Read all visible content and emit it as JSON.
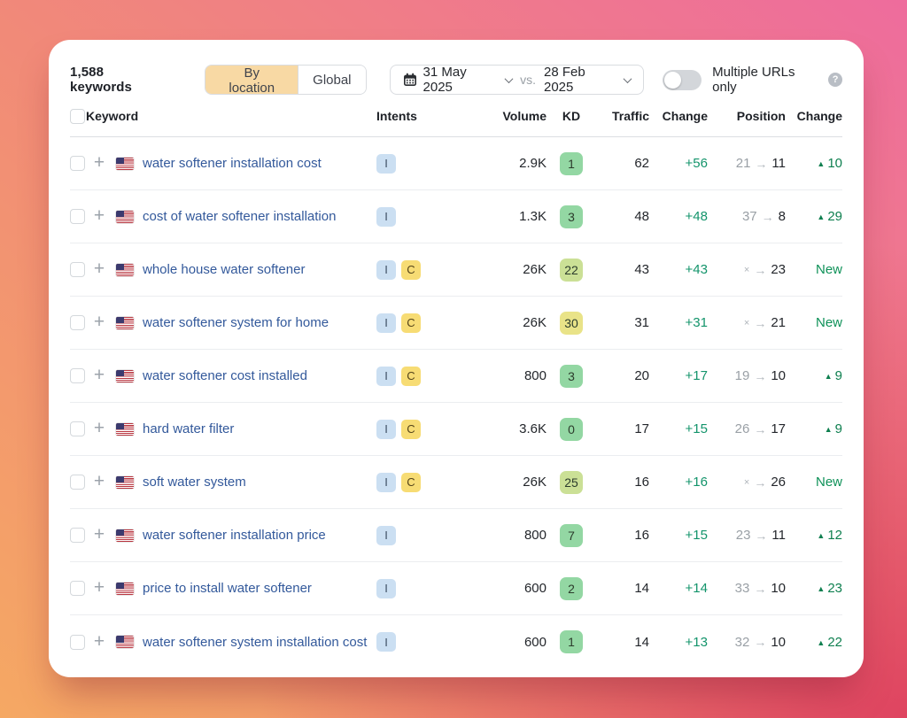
{
  "toolbar": {
    "keywords_count": "1,588 keywords",
    "view_toggle": {
      "by_location": "By location",
      "global": "Global",
      "active": "By location"
    },
    "date_picker": {
      "start_date": "31 May 2025",
      "separator": "vs.",
      "end_date": "28 Feb 2025"
    },
    "multiple_urls_toggle": {
      "label": "Multiple URLs only",
      "state": "off",
      "help_symbol": "?"
    }
  },
  "table": {
    "columns": [
      "Keyword",
      "Intents",
      "Volume",
      "KD",
      "Traffic",
      "Change",
      "Position",
      "Change"
    ],
    "symbols": {
      "position_arrow": "→",
      "up_triangle": "▲",
      "not_ranked": "×",
      "add": "+"
    },
    "rows": [
      {
        "keyword": "water softener installation cost",
        "country": "us",
        "intents": [
          "I"
        ],
        "volume": "2.9K",
        "kd": "1",
        "kd_level": "green",
        "traffic": "62",
        "change": "+56",
        "position_from": "21",
        "position_to": "11",
        "position_change": "10",
        "position_change_type": "up"
      },
      {
        "keyword": "cost of water softener installation",
        "country": "us",
        "intents": [
          "I"
        ],
        "volume": "1.3K",
        "kd": "3",
        "kd_level": "green",
        "traffic": "48",
        "change": "+48",
        "position_from": "37",
        "position_to": "8",
        "position_change": "29",
        "position_change_type": "up"
      },
      {
        "keyword": "whole house water softener",
        "country": "us",
        "intents": [
          "I",
          "C"
        ],
        "volume": "26K",
        "kd": "22",
        "kd_level": "lime",
        "traffic": "43",
        "change": "+43",
        "position_from": "×",
        "position_to": "23",
        "position_change": "New",
        "position_change_type": "new"
      },
      {
        "keyword": "water softener system for home",
        "country": "us",
        "intents": [
          "I",
          "C"
        ],
        "volume": "26K",
        "kd": "30",
        "kd_level": "yellow",
        "traffic": "31",
        "change": "+31",
        "position_from": "×",
        "position_to": "21",
        "position_change": "New",
        "position_change_type": "new"
      },
      {
        "keyword": "water softener cost installed",
        "country": "us",
        "intents": [
          "I",
          "C"
        ],
        "volume": "800",
        "kd": "3",
        "kd_level": "green",
        "traffic": "20",
        "change": "+17",
        "position_from": "19",
        "position_to": "10",
        "position_change": "9",
        "position_change_type": "up"
      },
      {
        "keyword": "hard water filter",
        "country": "us",
        "intents": [
          "I",
          "C"
        ],
        "volume": "3.6K",
        "kd": "0",
        "kd_level": "green",
        "traffic": "17",
        "change": "+15",
        "position_from": "26",
        "position_to": "17",
        "position_change": "9",
        "position_change_type": "up"
      },
      {
        "keyword": "soft water system",
        "country": "us",
        "intents": [
          "I",
          "C"
        ],
        "volume": "26K",
        "kd": "25",
        "kd_level": "lime",
        "traffic": "16",
        "change": "+16",
        "position_from": "×",
        "position_to": "26",
        "position_change": "New",
        "position_change_type": "new"
      },
      {
        "keyword": "water softener installation price",
        "country": "us",
        "intents": [
          "I"
        ],
        "volume": "800",
        "kd": "7",
        "kd_level": "green",
        "traffic": "16",
        "change": "+15",
        "position_from": "23",
        "position_to": "11",
        "position_change": "12",
        "position_change_type": "up"
      },
      {
        "keyword": "price to install water softener",
        "country": "us",
        "intents": [
          "I"
        ],
        "volume": "600",
        "kd": "2",
        "kd_level": "green",
        "traffic": "14",
        "change": "+14",
        "position_from": "33",
        "position_to": "10",
        "position_change": "23",
        "position_change_type": "up"
      },
      {
        "keyword": "water softener system installation cost",
        "country": "us",
        "intents": [
          "I"
        ],
        "volume": "600",
        "kd": "1",
        "kd_level": "green",
        "traffic": "14",
        "change": "+13",
        "position_from": "32",
        "position_to": "10",
        "position_change": "22",
        "position_change_type": "up"
      }
    ]
  },
  "colors": {
    "card_bg": "#ffffff",
    "accent_peach": "#f8d9a4",
    "link_blue": "#33599b",
    "change_green": "#13946b",
    "position_change_green": "#0e7f4f",
    "kd_green": "#93d7a3",
    "kd_lime": "#cbe096",
    "kd_yellow": "#e9e388",
    "intent_informational_bg": "#cbdff2",
    "intent_commercial_bg": "#f7dc74",
    "bg_gradient_top_left": "#f0776a",
    "bg_gradient_top_right": "#ee6c9d",
    "bg_gradient_bottom_left": "#f5a863",
    "bg_gradient_bottom_right": "#dd3e5e"
  }
}
